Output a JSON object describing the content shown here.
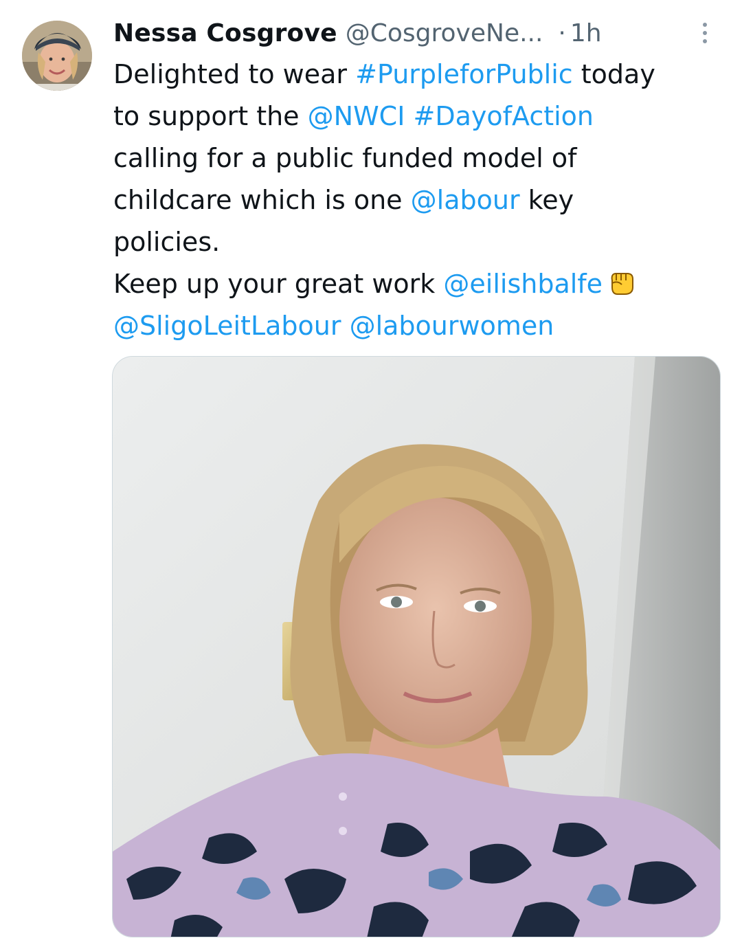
{
  "tweet": {
    "display_name": "Nessa Cosgrove",
    "handle": "@CosgroveNe...",
    "separator": "·",
    "time": "1h",
    "lines": [
      [
        {
          "t": "Delighted to wear "
        },
        {
          "t": "#PurpleforPublic",
          "link": true
        },
        {
          "t": " today"
        }
      ],
      [
        {
          "t": "to support the "
        },
        {
          "t": "@NWCI",
          "link": true
        },
        {
          "t": " "
        },
        {
          "t": "#DayofAction",
          "link": true
        }
      ],
      [
        {
          "t": "calling for a public funded model of"
        }
      ],
      [
        {
          "t": "childcare which is one "
        },
        {
          "t": "@labour",
          "link": true
        },
        {
          "t": " key"
        }
      ],
      [
        {
          "t": "policies."
        }
      ],
      [
        {
          "t": "Keep up your great work "
        },
        {
          "t": "@eilishbalfe",
          "link": true
        },
        {
          "emoji": "raised-fist"
        }
      ],
      [
        {
          "t": "@SligoLeitLabour",
          "link": true
        },
        {
          "t": " "
        },
        {
          "t": "@labourwomen",
          "link": true
        }
      ]
    ],
    "avatar_icon": "profile-photo",
    "more_icon": "more-options-icon",
    "media_icon": "attached-photo"
  },
  "colors": {
    "link": "#1d9bf0",
    "text": "#0f1419",
    "secondary": "#536471"
  }
}
